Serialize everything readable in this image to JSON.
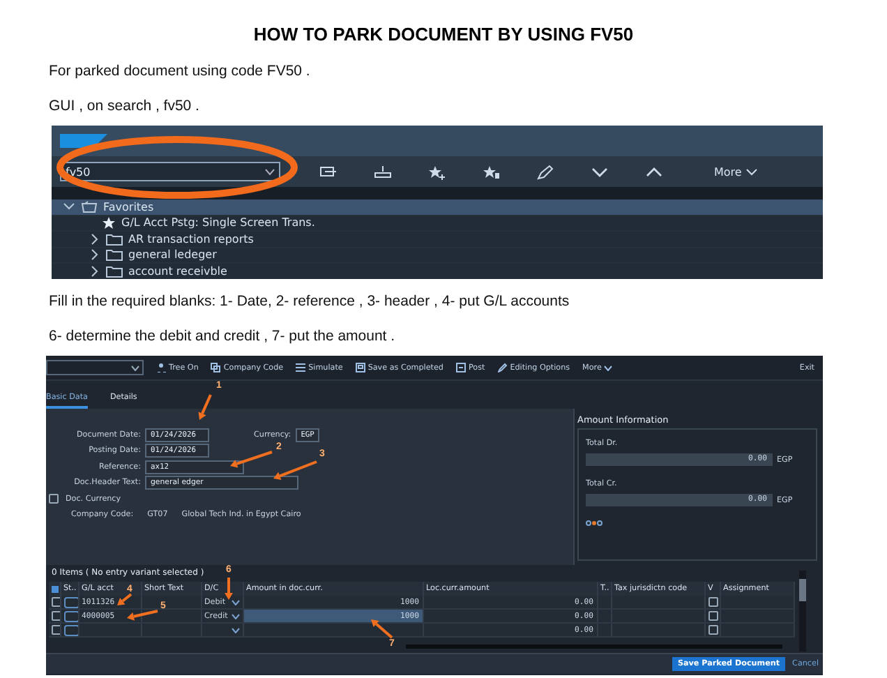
{
  "title": "HOW TO PARK DOCUMENT BY USING FV50",
  "intro": [
    "For parked document using code FV50 .",
    "GUI , on search , fv50 ."
  ],
  "launchpad": {
    "search": {
      "value": "fv50"
    },
    "more": "More",
    "tree": [
      {
        "label": "Favorites",
        "kind": "favorites",
        "expanded": true,
        "selected": true,
        "children": [
          {
            "label": "G/L Acct Pstg: Single Screen Trans.",
            "kind": "transaction",
            "selected": false
          },
          {
            "label": "AR transaction reports",
            "kind": "folder",
            "expanded": false,
            "selected": false
          },
          {
            "label": "general ledeger",
            "kind": "folder",
            "expanded": false,
            "selected": false
          },
          {
            "label": "account receivble",
            "kind": "folder",
            "expanded": false,
            "selected": false
          }
        ]
      }
    ]
  },
  "steps": [
    "Fill in the required blanks: 1- Date, 2- reference , 3- header , 4- put G/L accounts",
    "6- determine the debit and credit , 7- put the amount ."
  ],
  "fv50": {
    "toolbar": [
      "Tree On",
      "Company Code",
      "Simulate",
      "Save as Completed",
      "Post",
      "Editing Options"
    ],
    "more": "More",
    "exit": "Exit",
    "tabs": [
      {
        "label": "Basic Data",
        "selected": true
      },
      {
        "label": "Details",
        "selected": false
      }
    ],
    "fields": [
      {
        "label": "Document Date:",
        "value": "01/24/2026",
        "kind": "date"
      },
      {
        "label": "Posting Date:",
        "value": "01/24/2026",
        "kind": "date"
      },
      {
        "label": "Reference:",
        "value": "ax12",
        "kind": "short"
      },
      {
        "label": "Doc.Header Text:",
        "value": "general edger",
        "kind": "long"
      }
    ],
    "currency": {
      "label": "Currency:",
      "value": "EGP"
    },
    "doc_currency": {
      "label": "Doc. Currency",
      "checked": false
    },
    "company": {
      "label": "Company Code:",
      "code": "GT07",
      "name": "Global Tech Ind. in Egypt Cairo"
    },
    "amount_info": {
      "title": "Amount Information",
      "totals": [
        {
          "label": "Total Dr.",
          "value": "0.00",
          "currency": "EGP"
        },
        {
          "label": "Total Cr.",
          "value": "0.00",
          "currency": "EGP"
        }
      ]
    },
    "items_title": "0 Items ( No entry variant selected )",
    "columns": [
      "St..",
      "G/L acct",
      "Short Text",
      "D/C",
      "Amount in doc.curr.",
      "Loc.curr.amount",
      "T..",
      "Tax jurisdictn code",
      "V",
      "Assignment"
    ],
    "rows": [
      {
        "checked": false,
        "gl_acct": "1011326",
        "dc": "Debit",
        "amount": "1000",
        "loc_amount": "0.00",
        "focused": false,
        "v_checked": false
      },
      {
        "checked": false,
        "gl_acct": "4000005",
        "dc": "Credit",
        "amount": "1000",
        "loc_amount": "0.00",
        "focused": true,
        "v_checked": false
      },
      {
        "checked": false,
        "loc_amount": "0.00",
        "focused": false,
        "v_checked": false
      }
    ],
    "buttons": [
      {
        "label": "Save Parked Document",
        "kind": "primary"
      },
      {
        "label": "Cancel",
        "kind": "link"
      }
    ],
    "callouts": [
      "1",
      "2",
      "3",
      "4",
      "5",
      "6",
      "7"
    ]
  }
}
